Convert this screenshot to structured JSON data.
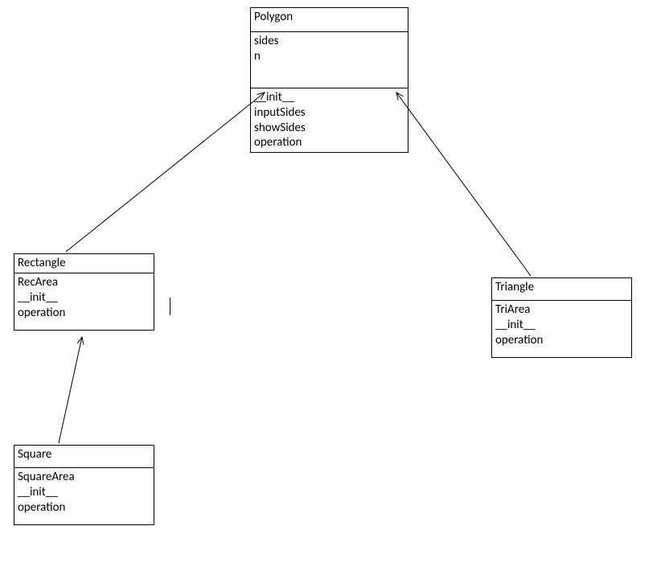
{
  "classes": {
    "polygon": {
      "name": "Polygon",
      "attributes": [
        "sides",
        "n"
      ],
      "methods": [
        "__init__",
        "inputSides",
        "showSides",
        "operation"
      ]
    },
    "rectangle": {
      "name": "Rectangle",
      "attributes": [],
      "methods": [
        "RecArea",
        "__init__",
        "operation"
      ]
    },
    "triangle": {
      "name": "Triangle",
      "attributes": [],
      "methods": [
        "TriArea",
        "__init__",
        "operation"
      ]
    },
    "square": {
      "name": "Square",
      "attributes": [],
      "methods": [
        "SquareArea",
        "__init__",
        "operation"
      ]
    }
  },
  "inheritance": [
    {
      "child": "rectangle",
      "parent": "polygon"
    },
    {
      "child": "triangle",
      "parent": "polygon"
    },
    {
      "child": "square",
      "parent": "rectangle"
    }
  ]
}
